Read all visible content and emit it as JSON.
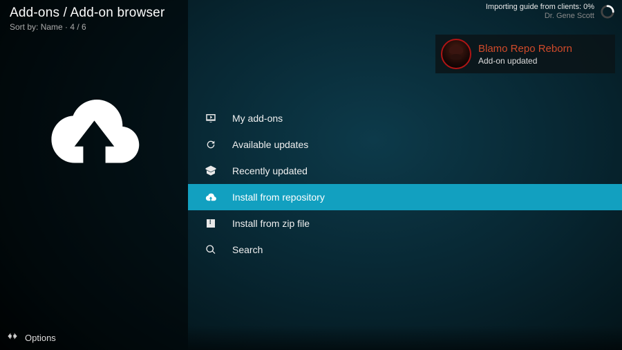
{
  "header": {
    "breadcrumb": "Add-ons / Add-on browser",
    "sort_prefix": "Sort by: ",
    "sort_field": "Name",
    "sort_separator": "  ·  ",
    "position": "4 / 6"
  },
  "status": {
    "line1": "Importing guide from clients:  0%",
    "line2": "Dr. Gene Scott"
  },
  "toast": {
    "title": "Blamo Repo Reborn",
    "subtitle": "Add-on updated",
    "icon": "blamo-repo-avatar"
  },
  "menu": {
    "items": [
      {
        "icon": "monitor-icon",
        "label": "My add-ons",
        "selected": false
      },
      {
        "icon": "refresh-icon",
        "label": "Available updates",
        "selected": false
      },
      {
        "icon": "open-box-icon",
        "label": "Recently updated",
        "selected": false
      },
      {
        "icon": "cloud-download-icon",
        "label": "Install from repository",
        "selected": true
      },
      {
        "icon": "zip-box-icon",
        "label": "Install from zip file",
        "selected": false
      },
      {
        "icon": "search-icon",
        "label": "Search",
        "selected": false
      }
    ]
  },
  "footer": {
    "options_label": "Options"
  },
  "sidebar": {
    "hero_icon": "cloud-download-icon"
  }
}
